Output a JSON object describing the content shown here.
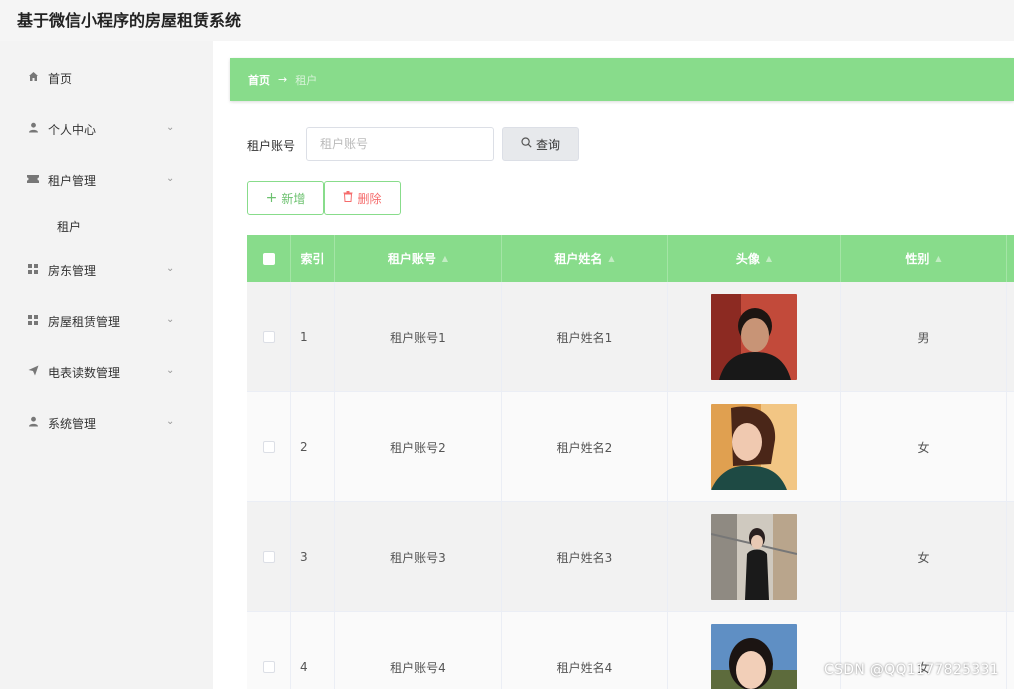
{
  "app": {
    "title": "基于微信小程序的房屋租赁系统"
  },
  "sidebar": {
    "items": [
      {
        "label": "首页",
        "icon": "home-icon",
        "expandable": false
      },
      {
        "label": "个人中心",
        "icon": "user-icon",
        "expandable": true
      },
      {
        "label": "租户管理",
        "icon": "ticket-icon",
        "expandable": true
      },
      {
        "label": "房东管理",
        "icon": "grid-icon",
        "expandable": true
      },
      {
        "label": "房屋租赁管理",
        "icon": "grid-icon",
        "expandable": true
      },
      {
        "label": "电表读数管理",
        "icon": "send-icon",
        "expandable": true
      },
      {
        "label": "系统管理",
        "icon": "user-icon",
        "expandable": true
      }
    ],
    "subitems": [
      {
        "label": "租户",
        "parent": "租户管理"
      }
    ]
  },
  "breadcrumb": {
    "home": "首页",
    "arrow": "→",
    "current": "租户"
  },
  "search": {
    "label": "租户账号",
    "placeholder": "租户账号",
    "value": "",
    "button_label": "查询"
  },
  "actions": {
    "add_label": "新增",
    "delete_label": "删除"
  },
  "table": {
    "columns": [
      {
        "key": "select",
        "label": ""
      },
      {
        "key": "index",
        "label": "索引",
        "sortable": false
      },
      {
        "key": "account",
        "label": "租户账号",
        "sortable": true
      },
      {
        "key": "name",
        "label": "租户姓名",
        "sortable": true
      },
      {
        "key": "avatar",
        "label": "头像",
        "sortable": true
      },
      {
        "key": "gender",
        "label": "性别",
        "sortable": true
      }
    ],
    "rows": [
      {
        "index": "1",
        "account": "租户账号1",
        "name": "租户姓名1",
        "gender": "男"
      },
      {
        "index": "2",
        "account": "租户账号2",
        "name": "租户姓名2",
        "gender": "女"
      },
      {
        "index": "3",
        "account": "租户账号3",
        "name": "租户姓名3",
        "gender": "女"
      },
      {
        "index": "4",
        "account": "租户账号4",
        "name": "租户姓名4",
        "gender": "女"
      }
    ]
  },
  "colors": {
    "accent": "#88dc8b",
    "danger": "#f56c6c",
    "sidebar_bg": "#f3f3f3"
  },
  "watermark": "CSDN @QQ1177825331"
}
